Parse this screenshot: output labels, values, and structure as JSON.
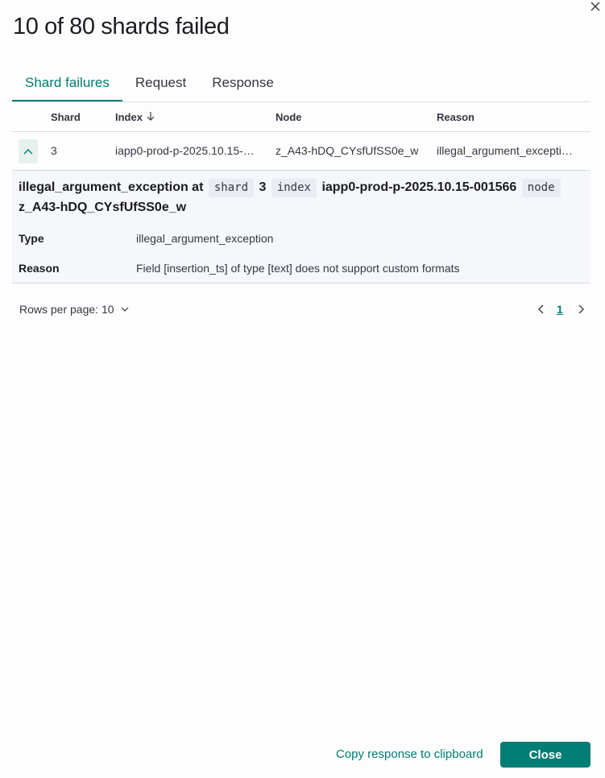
{
  "flyout": {
    "title": "10 of 80 shards failed"
  },
  "tabs": [
    {
      "label": "Shard failures",
      "active": true
    },
    {
      "label": "Request",
      "active": false
    },
    {
      "label": "Response",
      "active": false
    }
  ],
  "table": {
    "headers": {
      "shard": "Shard",
      "index": "Index",
      "node": "Node",
      "reason": "Reason"
    },
    "sort_icon": "arrow-down-icon",
    "rows": [
      {
        "shard": "3",
        "index": "iapp0-prod-p-2025.10.15-…",
        "node": "z_A43-hDQ_CYsfUfSS0e_w",
        "reason": "illegal_argument_excepti…",
        "expanded": true
      }
    ]
  },
  "detail": {
    "exception": "illegal_argument_exception at",
    "shard_tag": "shard",
    "shard_value": "3",
    "index_tag": "index",
    "index_value": "iapp0-prod-p-2025.10.15-001566",
    "node_tag": "node",
    "node_value": "z_A43-hDQ_CYsfUfSS0e_w",
    "type_label": "Type",
    "type_value": "illegal_argument_exception",
    "reason_label": "Reason",
    "reason_value": "Field [insertion_ts] of type [text] does not support custom formats"
  },
  "pagination": {
    "rows_per_page": "Rows per page: 10",
    "current_page": "1"
  },
  "footer": {
    "copy_label": "Copy response to clipboard",
    "close_label": "Close"
  },
  "colors": {
    "accent": "#017d73",
    "text": "#343741",
    "border": "#d3dae6",
    "detail_bg": "#f5f7fa"
  }
}
